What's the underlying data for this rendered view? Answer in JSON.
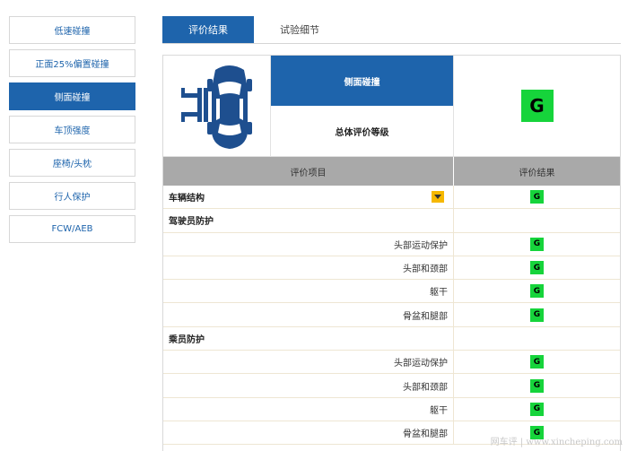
{
  "nav": {
    "items": [
      {
        "label": "低速碰撞",
        "active": false
      },
      {
        "label": "正面25%偏置碰撞",
        "active": false
      },
      {
        "label": "侧面碰撞",
        "active": true
      },
      {
        "label": "车顶强度",
        "active": false
      },
      {
        "label": "座椅/头枕",
        "active": false
      },
      {
        "label": "行人保护",
        "active": false
      },
      {
        "label": "FCW/AEB",
        "active": false
      }
    ]
  },
  "tabs": [
    {
      "label": "评价结果",
      "active": true
    },
    {
      "label": "试验细节",
      "active": false
    }
  ],
  "summary": {
    "test_name": "侧面碰撞",
    "overall_label": "总体评价等级",
    "overall_grade": "G",
    "car_icon": "side-impact-car-icon"
  },
  "table": {
    "header_item": "评价项目",
    "header_result": "评价结果",
    "rows": [
      {
        "type": "group",
        "label": "车辆结构",
        "grade": "G",
        "dropdown": true
      },
      {
        "type": "group",
        "label": "驾驶员防护",
        "grade": ""
      },
      {
        "type": "sub",
        "label": "头部运动保护",
        "grade": "G"
      },
      {
        "type": "sub",
        "label": "头部和颈部",
        "grade": "G"
      },
      {
        "type": "sub",
        "label": "躯干",
        "grade": "G"
      },
      {
        "type": "sub",
        "label": "骨盆和腿部",
        "grade": "G"
      },
      {
        "type": "group",
        "label": "乘员防护",
        "grade": ""
      },
      {
        "type": "sub",
        "label": "头部运动保护",
        "grade": "G"
      },
      {
        "type": "sub",
        "label": "头部和颈部",
        "grade": "G"
      },
      {
        "type": "sub",
        "label": "躯干",
        "grade": "G"
      },
      {
        "type": "sub",
        "label": "骨盆和腿部",
        "grade": "G"
      }
    ]
  },
  "colors": {
    "accent": "#1e64ac",
    "grade_good": "#16d43b",
    "dropdown": "#f6b800",
    "table_header": "#a9a9a9"
  },
  "watermark": "网车评 | www.xincheping.com"
}
